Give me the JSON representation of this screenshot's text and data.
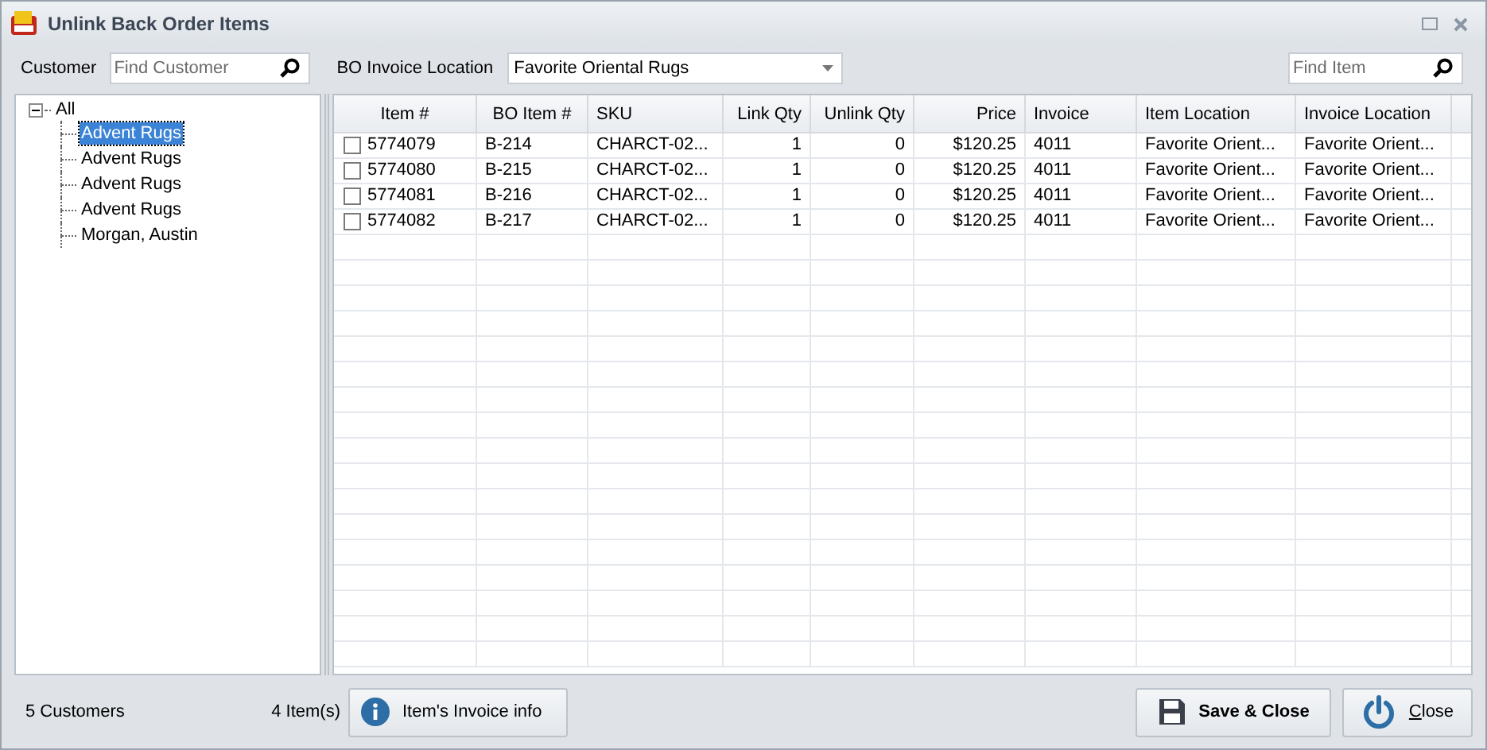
{
  "window": {
    "title": "Unlink Back Order Items"
  },
  "customer_search": {
    "label": "Customer",
    "placeholder": "Find Customer"
  },
  "bo_invoice_location": {
    "label": "BO Invoice Location",
    "value": "Favorite Oriental Rugs"
  },
  "item_search": {
    "placeholder": "Find Item"
  },
  "tree": {
    "label": "All",
    "expanded": true,
    "children": [
      {
        "label": "Advent Rugs",
        "selected": true
      },
      {
        "label": "Advent Rugs",
        "selected": false
      },
      {
        "label": "Advent Rugs",
        "selected": false
      },
      {
        "label": "Advent Rugs",
        "selected": false
      },
      {
        "label": "Morgan, Austin",
        "selected": false
      }
    ]
  },
  "table": {
    "columns": [
      {
        "label": "Item #"
      },
      {
        "label": "BO Item #"
      },
      {
        "label": "SKU"
      },
      {
        "label": "Link Qty"
      },
      {
        "label": "Unlink Qty"
      },
      {
        "label": "Price"
      },
      {
        "label": "Invoice"
      },
      {
        "label": "Item Location"
      },
      {
        "label": "Invoice Location"
      }
    ],
    "rows": [
      {
        "checked": false,
        "cells": [
          "5774079",
          "B-214",
          "CHARCT-02...",
          "1",
          "0",
          "$120.25",
          "4011",
          "Favorite Orient...",
          "Favorite Orient..."
        ]
      },
      {
        "checked": false,
        "cells": [
          "5774080",
          "B-215",
          "CHARCT-02...",
          "1",
          "0",
          "$120.25",
          "4011",
          "Favorite Orient...",
          "Favorite Orient..."
        ]
      },
      {
        "checked": false,
        "cells": [
          "5774081",
          "B-216",
          "CHARCT-02...",
          "1",
          "0",
          "$120.25",
          "4011",
          "Favorite Orient...",
          "Favorite Orient..."
        ]
      },
      {
        "checked": false,
        "cells": [
          "5774082",
          "B-217",
          "CHARCT-02...",
          "1",
          "0",
          "$120.25",
          "4011",
          "Favorite Orient...",
          "Favorite Orient..."
        ]
      }
    ]
  },
  "status_bar": {
    "customers": "5 Customers",
    "items": "4 Item(s)"
  },
  "buttons": [
    {
      "kind": "info",
      "label": "Item's Invoice info"
    },
    {
      "kind": "save",
      "label": "Save & Close"
    },
    {
      "kind": "close",
      "label": "Close"
    }
  ]
}
